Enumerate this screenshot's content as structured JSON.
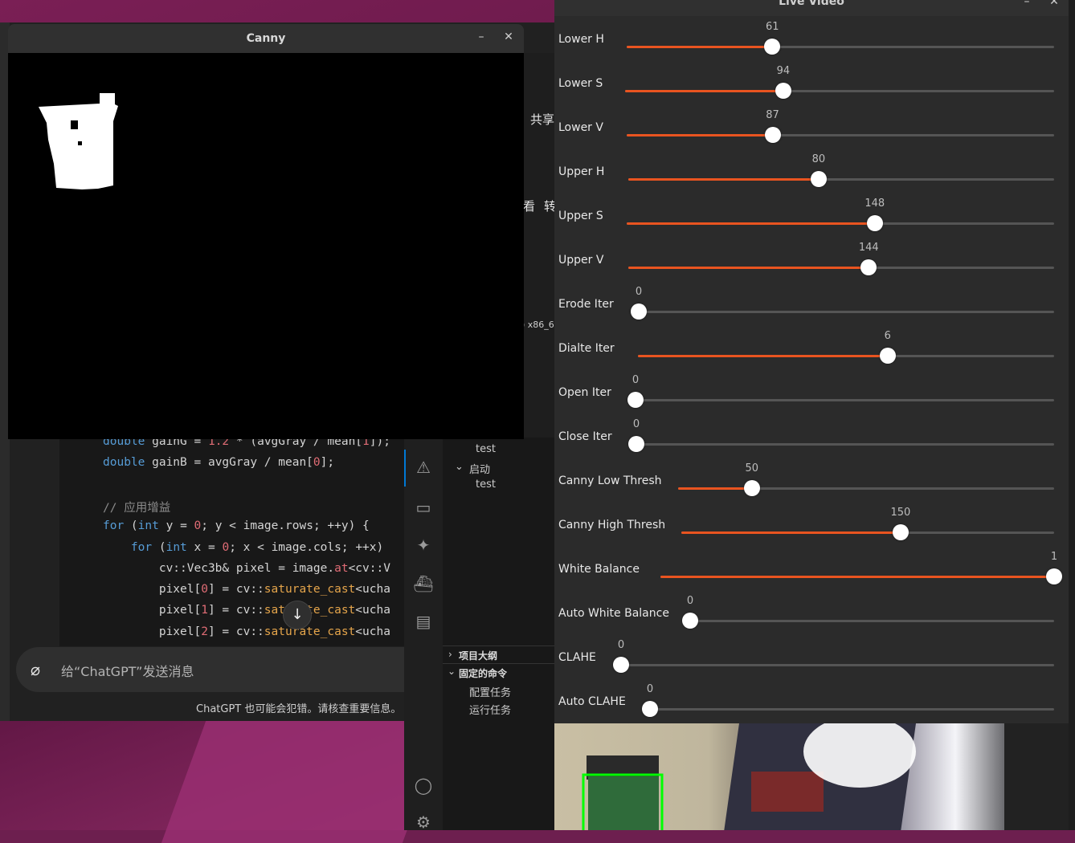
{
  "canny_window": {
    "title": "Canny"
  },
  "live_window": {
    "title": "Live Video",
    "sliders": [
      {
        "label": "Lower H",
        "value": 61,
        "max": 179
      },
      {
        "label": "Lower S",
        "value": 94,
        "max": 255
      },
      {
        "label": "Lower V",
        "value": 87,
        "max": 255
      },
      {
        "label": "Upper H",
        "value": 80,
        "max": 179
      },
      {
        "label": "Upper S",
        "value": 148,
        "max": 255
      },
      {
        "label": "Upper V",
        "value": 144,
        "max": 255
      },
      {
        "label": "Erode Iter",
        "value": 0,
        "max": 10
      },
      {
        "label": "Dialte Iter",
        "value": 6,
        "max": 10
      },
      {
        "label": "Open Iter",
        "value": 0,
        "max": 10
      },
      {
        "label": "Close Iter",
        "value": 0,
        "max": 10
      },
      {
        "label": "Canny Low Thresh",
        "value": 50,
        "max": 255
      },
      {
        "label": "Canny High Thresh",
        "value": 150,
        "max": 255
      },
      {
        "label": "White Balance",
        "value": 1,
        "max": 1
      },
      {
        "label": "Auto White Balance",
        "value": 0,
        "max": 1
      },
      {
        "label": "CLAHE",
        "value": 0,
        "max": 1
      },
      {
        "label": "Auto CLAHE",
        "value": 0,
        "max": 1
      }
    ]
  },
  "code_lines": [
    {
      "kind": "html",
      "text": "<span class='kw'>double</span> gainG = <span class='num'>1.2</span> * (avgGray / mean[<span class='num'>1</span>]);"
    },
    {
      "kind": "html",
      "text": "<span class='kw'>double</span> gainB = avgGray / mean[<span class='num'>0</span>];"
    },
    {
      "kind": "html",
      "text": ""
    },
    {
      "kind": "html",
      "text": "<span class='cm'>// 应用增益</span>"
    },
    {
      "kind": "html",
      "text": "<span class='kw'>for</span> (<span class='kw'>int</span> y = <span class='num'>0</span>; y &lt; image.rows; ++y) {"
    },
    {
      "kind": "html",
      "text": "    <span class='kw'>for</span> (<span class='kw'>int</span> x = <span class='num'>0</span>; x &lt; image.cols; ++x)"
    },
    {
      "kind": "html",
      "text": "        cv::Vec3b&amp; pixel = image.<span class='mem'>at</span>&lt;cv::V"
    },
    {
      "kind": "html",
      "text": "        pixel[<span class='num'>0</span>] = cv::<span class='fn'>saturate_cast</span>&lt;ucha"
    },
    {
      "kind": "html",
      "text": "        pixel[<span class='num'>1</span>] = cv::<span class='fn'>saturate_cast</span>&lt;ucha"
    },
    {
      "kind": "html",
      "text": "        pixel[<span class='num'>2</span>] = cv::<span class='fn'>saturate_cast</span>&lt;ucha"
    }
  ],
  "chat": {
    "placeholder": "给“ChatGPT”发送消息",
    "disclaimer": "ChatGPT 也可能会犯错。请核查重要信息。"
  },
  "vscode": {
    "tree": [
      "test",
      "启动",
      "test"
    ],
    "outline_label": "项目大纲",
    "pinned_label": "固定的命令",
    "tasks": [
      "配置任务",
      "运行任务"
    ]
  },
  "bg_fragments": {
    "share": "共享",
    "view": "看",
    "convert": "转",
    "arch": ") x86_6"
  },
  "colors": {
    "accent": "#e95420",
    "detect_box": "#00ff00"
  }
}
